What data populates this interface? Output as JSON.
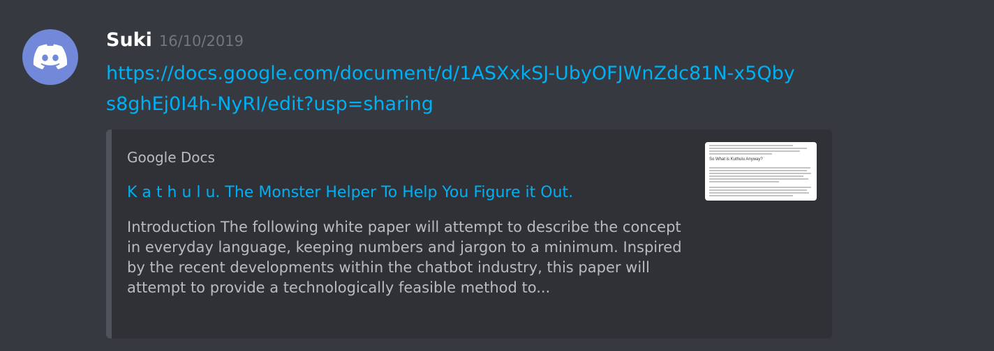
{
  "message": {
    "username": "Suki",
    "timestamp": "16/10/2019",
    "avatar_icon": "discord-logo-icon",
    "link_text": "https://docs.google.com/document/d/1ASXxkSJ-UbyOFJWnZdc81N-x5Qbys8ghEj0I4h-NyRI/edit?usp=sharing"
  },
  "embed": {
    "provider": "Google Docs",
    "title": "K a t h u l u. The Monster Helper To Help You Figure it Out.",
    "description": "Introduction The following white paper will attempt to describe the concept in everyday language, keeping numbers and jargon to a minimum. Inspired by the recent developments within the chatbot industry, this paper will attempt to provide a technologically feasible method to...",
    "thumbnail_heading": "So What is Kuthulu Anyway?"
  },
  "colors": {
    "background": "#36393f",
    "embed_background": "#2f3136",
    "link": "#00b0f4",
    "avatar": "#7289da"
  }
}
